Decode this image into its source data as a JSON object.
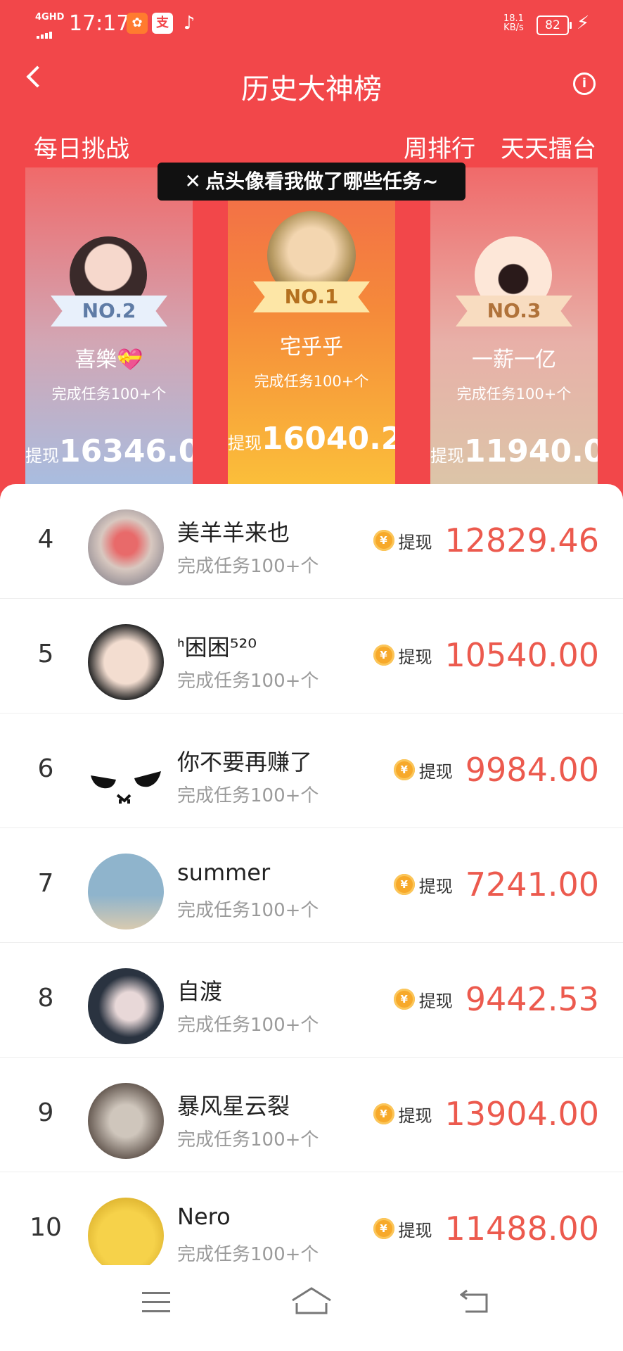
{
  "status_bar": {
    "network": "4GHD",
    "time": "17:17",
    "app_icons": [
      "app-badge-icon",
      "alipay-icon",
      "tiktok-icon"
    ],
    "net_speed": "18.1",
    "net_unit": "KB/s",
    "battery": "82"
  },
  "header": {
    "title": "历史大神榜"
  },
  "tabs": {
    "daily": "每日挑战",
    "weekly": "周排行",
    "arena": "天天擂台"
  },
  "tooltip": {
    "text": "点头像看我做了哪些任务~"
  },
  "podium": [
    {
      "badge": "NO.2",
      "name": "喜樂💝",
      "task": "完成任务100+个",
      "cash_label": "提现",
      "amount": "16346.0"
    },
    {
      "badge": "NO.1",
      "name": "宅乎乎",
      "task": "完成任务100+个",
      "cash_label": "提现",
      "amount": "16040.2"
    },
    {
      "badge": "NO.3",
      "name": "一薪一亿",
      "task": "完成任务100+个",
      "cash_label": "提现",
      "amount": "11940.0"
    }
  ],
  "list": [
    {
      "rank": "4",
      "name": "美羊羊来也",
      "task": "完成任务100+个",
      "cash_label": "提现",
      "amount": "12829.46"
    },
    {
      "rank": "5",
      "name": "ᑋ困困⁵²⁰",
      "task": "完成任务100+个",
      "cash_label": "提现",
      "amount": "10540.00"
    },
    {
      "rank": "6",
      "name": "你不要再赚了",
      "task": "完成任务100+个",
      "cash_label": "提现",
      "amount": "9984.00"
    },
    {
      "rank": "7",
      "name": "summer",
      "task": "完成任务100+个",
      "cash_label": "提现",
      "amount": "7241.00"
    },
    {
      "rank": "8",
      "name": "自渡",
      "task": "完成任务100+个",
      "cash_label": "提现",
      "amount": "9442.53"
    },
    {
      "rank": "9",
      "name": "暴风星云裂",
      "task": "完成任务100+个",
      "cash_label": "提现",
      "amount": "13904.00"
    },
    {
      "rank": "10",
      "name": "Nero",
      "task": "完成任务100+个",
      "cash_label": "提现",
      "amount": "11488.00"
    }
  ],
  "colors": {
    "header_red": "#f2474a",
    "amount_red": "#ec5a4e",
    "coin_gold": "#f7a92a"
  }
}
